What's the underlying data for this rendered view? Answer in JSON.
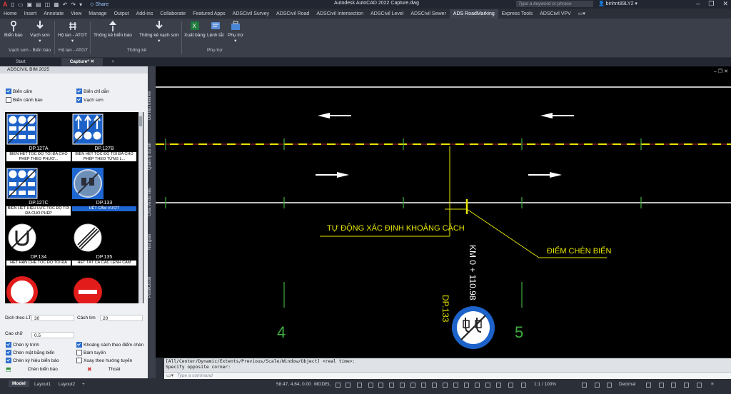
{
  "titlebar": {
    "app_logo": "A",
    "share": "Share",
    "doc_title": "Autodesk AutoCAD 2022   Capture.dwg",
    "search_placeholder": "Type a keyword or phrase",
    "user": "binhnt89LY2"
  },
  "ribbon_tabs": [
    "Home",
    "Insert",
    "Annotate",
    "View",
    "Manage",
    "Output",
    "Add-ins",
    "Collaborate",
    "Featured Apps",
    "ADSCivil Survey",
    "ADSCivil Road",
    "ADSCivil Intersection",
    "ADSCivil Level",
    "ADSCivil Sewer",
    "ADS RoadMarking",
    "Express Tools",
    "ADSCivil VPV"
  ],
  "ribbon_active": "ADS RoadMarking",
  "ribbon": {
    "buttons": {
      "bien_bao": "Biển báo",
      "vach_son": "Vạch sơn",
      "ho_lan": "Hộ lan - ATGT",
      "thong_ke_bien_bao": "Thống kê biển báo",
      "thong_ke_vach_son": "Thống kê vạch sơn",
      "xuat_bang": "Xuất bảng",
      "lenh_tat": "Lệnh tắt",
      "phu_tro": "Phụ trợ"
    },
    "groups": {
      "g1": "Vạch sơn - Biển báo",
      "g2": "Hộ lan - ATGT",
      "g3": "Thống kê",
      "g4": "Phụ trợ"
    }
  },
  "file_tabs": [
    "Start",
    "Capture*"
  ],
  "palette": {
    "title": "ADSCIVIL BIM 2025",
    "filters": [
      {
        "label": "Biển cấm",
        "checked": true
      },
      {
        "label": "Biển chỉ dẫn",
        "checked": true
      },
      {
        "label": "Biển cảnh báo",
        "checked": false
      },
      {
        "label": "Vạch sơn",
        "checked": true
      }
    ],
    "signs": [
      {
        "code": "DP.127A",
        "desc": "BIỂN HẾT TỐC ĐỘ TỐI ĐA CHO PHÉP THEO PHƯƠ...",
        "selected": false
      },
      {
        "code": "DP.127B",
        "desc": "BIỂN HẾT TỐC ĐỘ TỐI ĐA CHO PHÉP THEO TỪNG L...",
        "selected": false
      },
      {
        "code": "DP.127C",
        "desc": "BIỂN HẾT HIỆU LỰC TỐC ĐỘ TỐI ĐA CHO PHÉP",
        "selected": false
      },
      {
        "code": "DP.133",
        "desc": "HẾT CẤM VƯỢT",
        "selected": true
      },
      {
        "code": "DP.134",
        "desc": "HẾT HẠN CHẾ TỐC ĐỘ TỐI ĐA",
        "selected": false
      },
      {
        "code": "DP.135",
        "desc": "HẾT TẤT CẢ CÁC LỆNH CẤM",
        "selected": false
      },
      {
        "code": "",
        "desc": "",
        "selected": false
      },
      {
        "code": "",
        "desc": "",
        "selected": false
      }
    ],
    "dich_theo_lt_label": "Dịch theo LT",
    "dich_theo_lt_value": "30",
    "cach_tim_label": "Cách tim",
    "cach_tim_value": "20",
    "cao_chu_label": "Cao chữ",
    "cao_chu_value": "0.5",
    "options": [
      {
        "label": "Chèn lý trình",
        "checked": true
      },
      {
        "label": "Khoảng cách theo điểm chèn",
        "checked": true
      },
      {
        "label": "Chèn mặt bằng biển",
        "checked": true
      },
      {
        "label": "Bám tuyến",
        "checked": false
      },
      {
        "label": "Chèn ký hiệu biển báo",
        "checked": true
      },
      {
        "label": "Xoay theo hướng tuyến",
        "checked": false
      }
    ],
    "insert_button": "Chèn biển báo",
    "exit_button": "Thoát"
  },
  "side_tabs": [
    "Dữ liệu thiết kế",
    "Quản lý dự án",
    "Chia và dữ liệu",
    "Nút giao",
    "PointCloud"
  ],
  "canvas": {
    "auto_distance_label": "TỰ ĐỘNG XÁC ĐỊNH KHOẢNG CÁCH",
    "insert_point_label": "ĐIỂM CHÈN BIỂN",
    "km_label": "KM 0 + 110.98",
    "sign_label": "DP.133",
    "grid_num_left": "4",
    "grid_num_right": "5",
    "colors": {
      "white": "#ffffff",
      "yellow": "#e6e600",
      "red": "#ff3030",
      "green": "#3fae3f",
      "background": "#000000"
    }
  },
  "command": {
    "line1": "[All/Center/Dynamic/Extents/Previous/Scale/Window/Object] <real time>:",
    "line2": "Specify opposite corner:",
    "placeholder": "Type a command"
  },
  "status": {
    "tabs": [
      "Model",
      "Layout1",
      "Layout2"
    ],
    "active_tab": "Model",
    "coords": "58.47, 4.64, 0.00",
    "mode": "MODEL",
    "scale": "1:1 / 100%",
    "units": "Decimal"
  }
}
